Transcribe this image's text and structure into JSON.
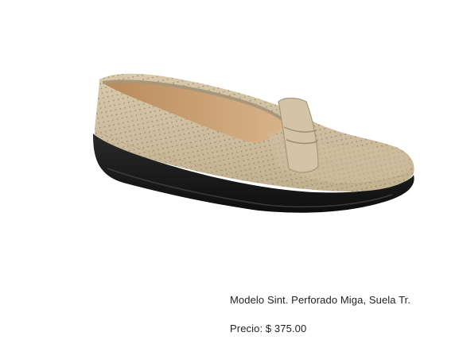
{
  "product": {
    "image_subject": "shoe-loafer-beige-perforated",
    "model_text": "Modelo Sint. Perforado Miga, Suela Tr.",
    "price_text": "Precio: $ 375.00"
  },
  "colors": {
    "upper": "#cdbd9e",
    "sole": "#1a1a1a",
    "lining": "#c49a6c",
    "background": "#ffffff"
  }
}
